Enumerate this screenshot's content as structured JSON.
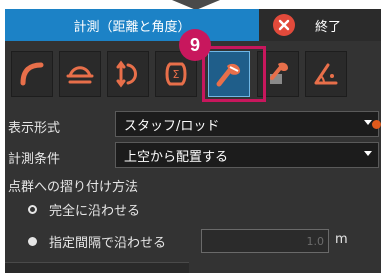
{
  "window": {
    "title": "計測（距離と角度）",
    "close_label": "終了"
  },
  "callout": {
    "step_number": "9"
  },
  "toolbar": {
    "tools": [
      {
        "name": "curve-measure-icon"
      },
      {
        "name": "cross-section-icon"
      },
      {
        "name": "height-measure-icon"
      },
      {
        "name": "area-measure-icon"
      },
      {
        "name": "staff-rod-icon",
        "active": true
      },
      {
        "name": "staff-place-icon"
      },
      {
        "name": "angle-measure-icon"
      }
    ]
  },
  "form": {
    "display_format_label": "表示形式",
    "display_format_value": "スタッフ/ロッド",
    "condition_label": "計測条件",
    "condition_value": "上空から配置する",
    "fit_method_label": "点群への摺り付け方法",
    "fit_options": [
      {
        "label": "完全に沿わせる",
        "selected": false
      },
      {
        "label": "指定間隔で沿わせる",
        "selected": true
      }
    ],
    "interval_value": "1.0",
    "interval_unit": "m"
  },
  "colors": {
    "title_blue": "#1c82c6",
    "highlight_magenta": "#c8175d",
    "close_red": "#e24a3b",
    "accent_orange": "#e05a1c"
  }
}
